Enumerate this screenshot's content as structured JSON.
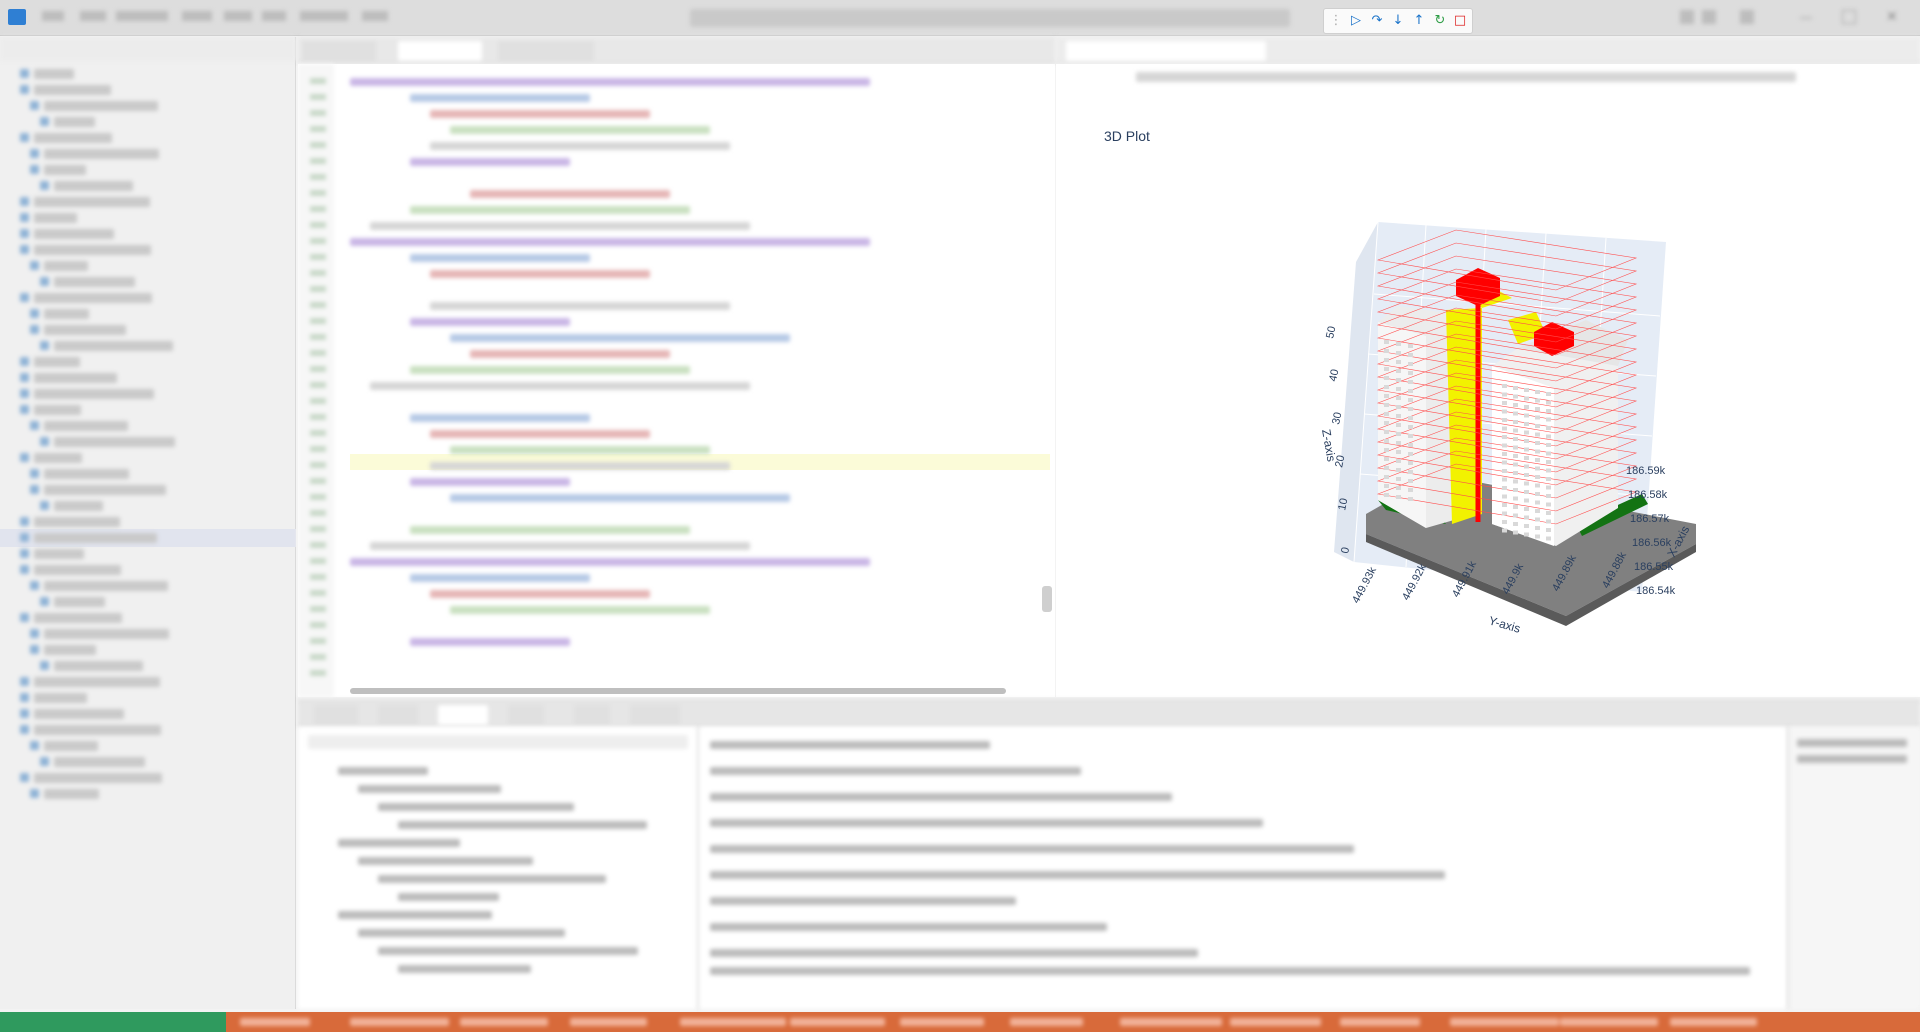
{
  "plot": {
    "title": "3D Plot",
    "z_axis_title": "Z-axis",
    "x_axis_title": "X-axis",
    "y_axis_title": "Y-axis",
    "z_ticks": [
      "0",
      "10",
      "20",
      "30",
      "40",
      "50"
    ],
    "x_ticks": [
      "186.54k",
      "186.55k",
      "186.56k",
      "186.57k",
      "186.58k",
      "186.59k"
    ],
    "y_ticks": [
      "449.93k",
      "449.92k",
      "449.91k",
      "449.9k",
      "449.89k",
      "449.88k"
    ],
    "colors": {
      "building": "#ffffff",
      "core_fill": "#f2f200",
      "core_line": "#ff0000",
      "roof_blocks": "#ff0000",
      "ground_slab": "#808080",
      "green_edge": "#137313",
      "scene_background": "#e5ecf6",
      "floor_outline": "#ff4d4d"
    }
  },
  "icons": {
    "continue": "continue-icon",
    "step_over": "step-over-icon",
    "step_into": "step-into-icon",
    "step_out": "step-out-icon",
    "restart": "restart-icon",
    "stop": "stop-icon"
  }
}
